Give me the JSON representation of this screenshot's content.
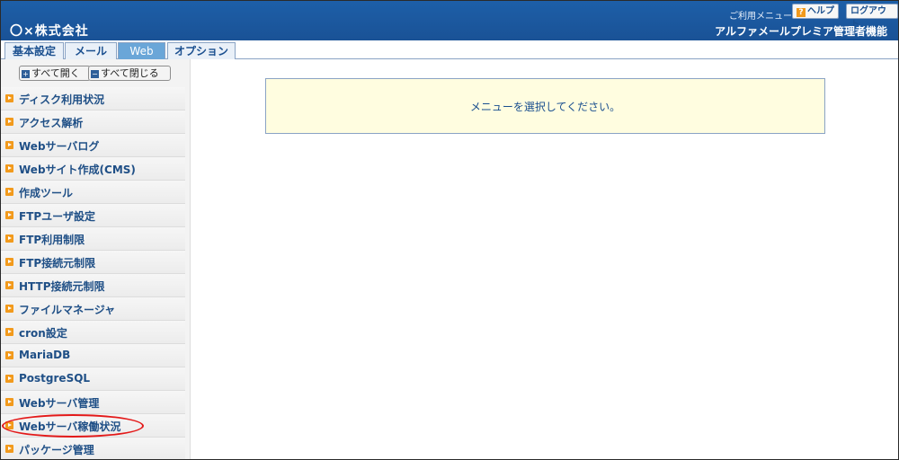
{
  "header": {
    "company": "〇×株式会社",
    "usermenu_label": "ご利用メニュー",
    "help_label": "ヘルプ",
    "help_icon": "?",
    "logout_label": "ログアウト",
    "subtitle": "アルファメールプレミア管理者機能"
  },
  "tabs": [
    "基本設定",
    "メール",
    "Web",
    "オプション"
  ],
  "active_tab": "Web",
  "sidebar": {
    "expand_all": "すべて開く",
    "collapse_all": "すべて閉じる",
    "items": [
      "ディスク利用状況",
      "アクセス解析",
      "Webサーバログ",
      "Webサイト作成(CMS)",
      "作成ツール",
      "FTPユーザ設定",
      "FTP利用制限",
      "FTP接続元制限",
      "HTTP接続元制限",
      "ファイルマネージャ",
      "cron設定",
      "MariaDB",
      "PostgreSQL",
      "Webサーバ管理",
      "Webサーバ稼働状況",
      "パッケージ管理"
    ],
    "highlighted_item": "Webサーバ稼働状況"
  },
  "main": {
    "message": "メニューを選択してください。"
  },
  "colors": {
    "header_bg": "#1d5fa8",
    "tab_active_bg": "#6aa6d8",
    "menu_text": "#1f4f86",
    "arrow_icon": "#f29a1c",
    "notice_bg": "#fffde0",
    "highlight_ring": "#e31919"
  }
}
